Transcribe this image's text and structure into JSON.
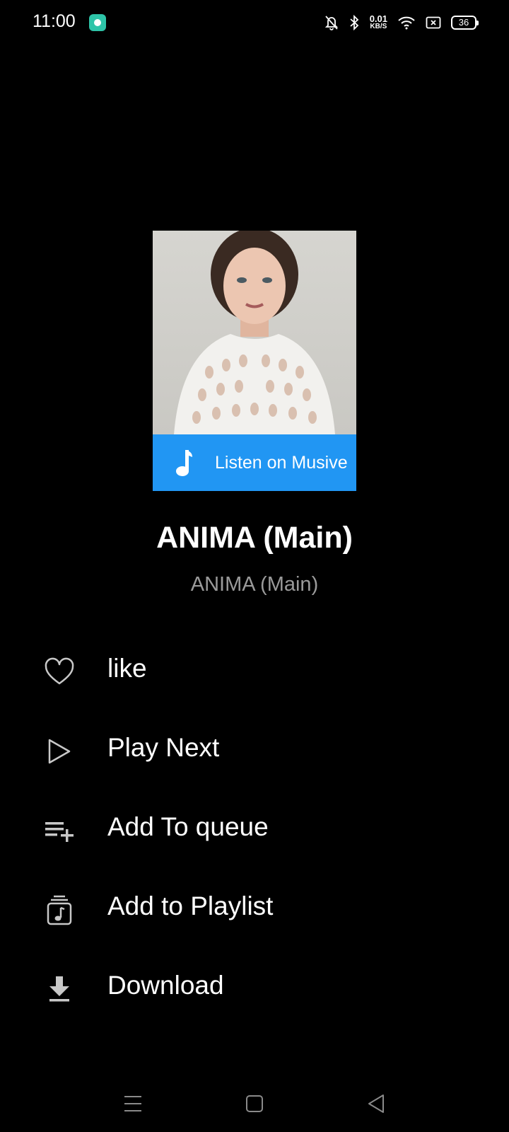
{
  "status_bar": {
    "time": "11:00",
    "net_speed_value": "0.01",
    "net_speed_unit": "KB/S",
    "battery": "36"
  },
  "album": {
    "listen_label": "Listen on Musive",
    "accent_color": "#2196f3"
  },
  "track": {
    "title": "ANIMA (Main)",
    "subtitle": "ANIMA (Main)"
  },
  "menu": {
    "items": [
      {
        "label": "like",
        "icon": "heart-icon"
      },
      {
        "label": "Play Next",
        "icon": "play-outline-icon"
      },
      {
        "label": "Add To queue",
        "icon": "add-to-queue-icon"
      },
      {
        "label": "Add to Playlist",
        "icon": "playlist-music-icon"
      },
      {
        "label": "Download",
        "icon": "download-icon"
      }
    ]
  },
  "nav_bar": {
    "buttons": [
      "menu-icon",
      "home-square-icon",
      "back-triangle-icon"
    ]
  }
}
